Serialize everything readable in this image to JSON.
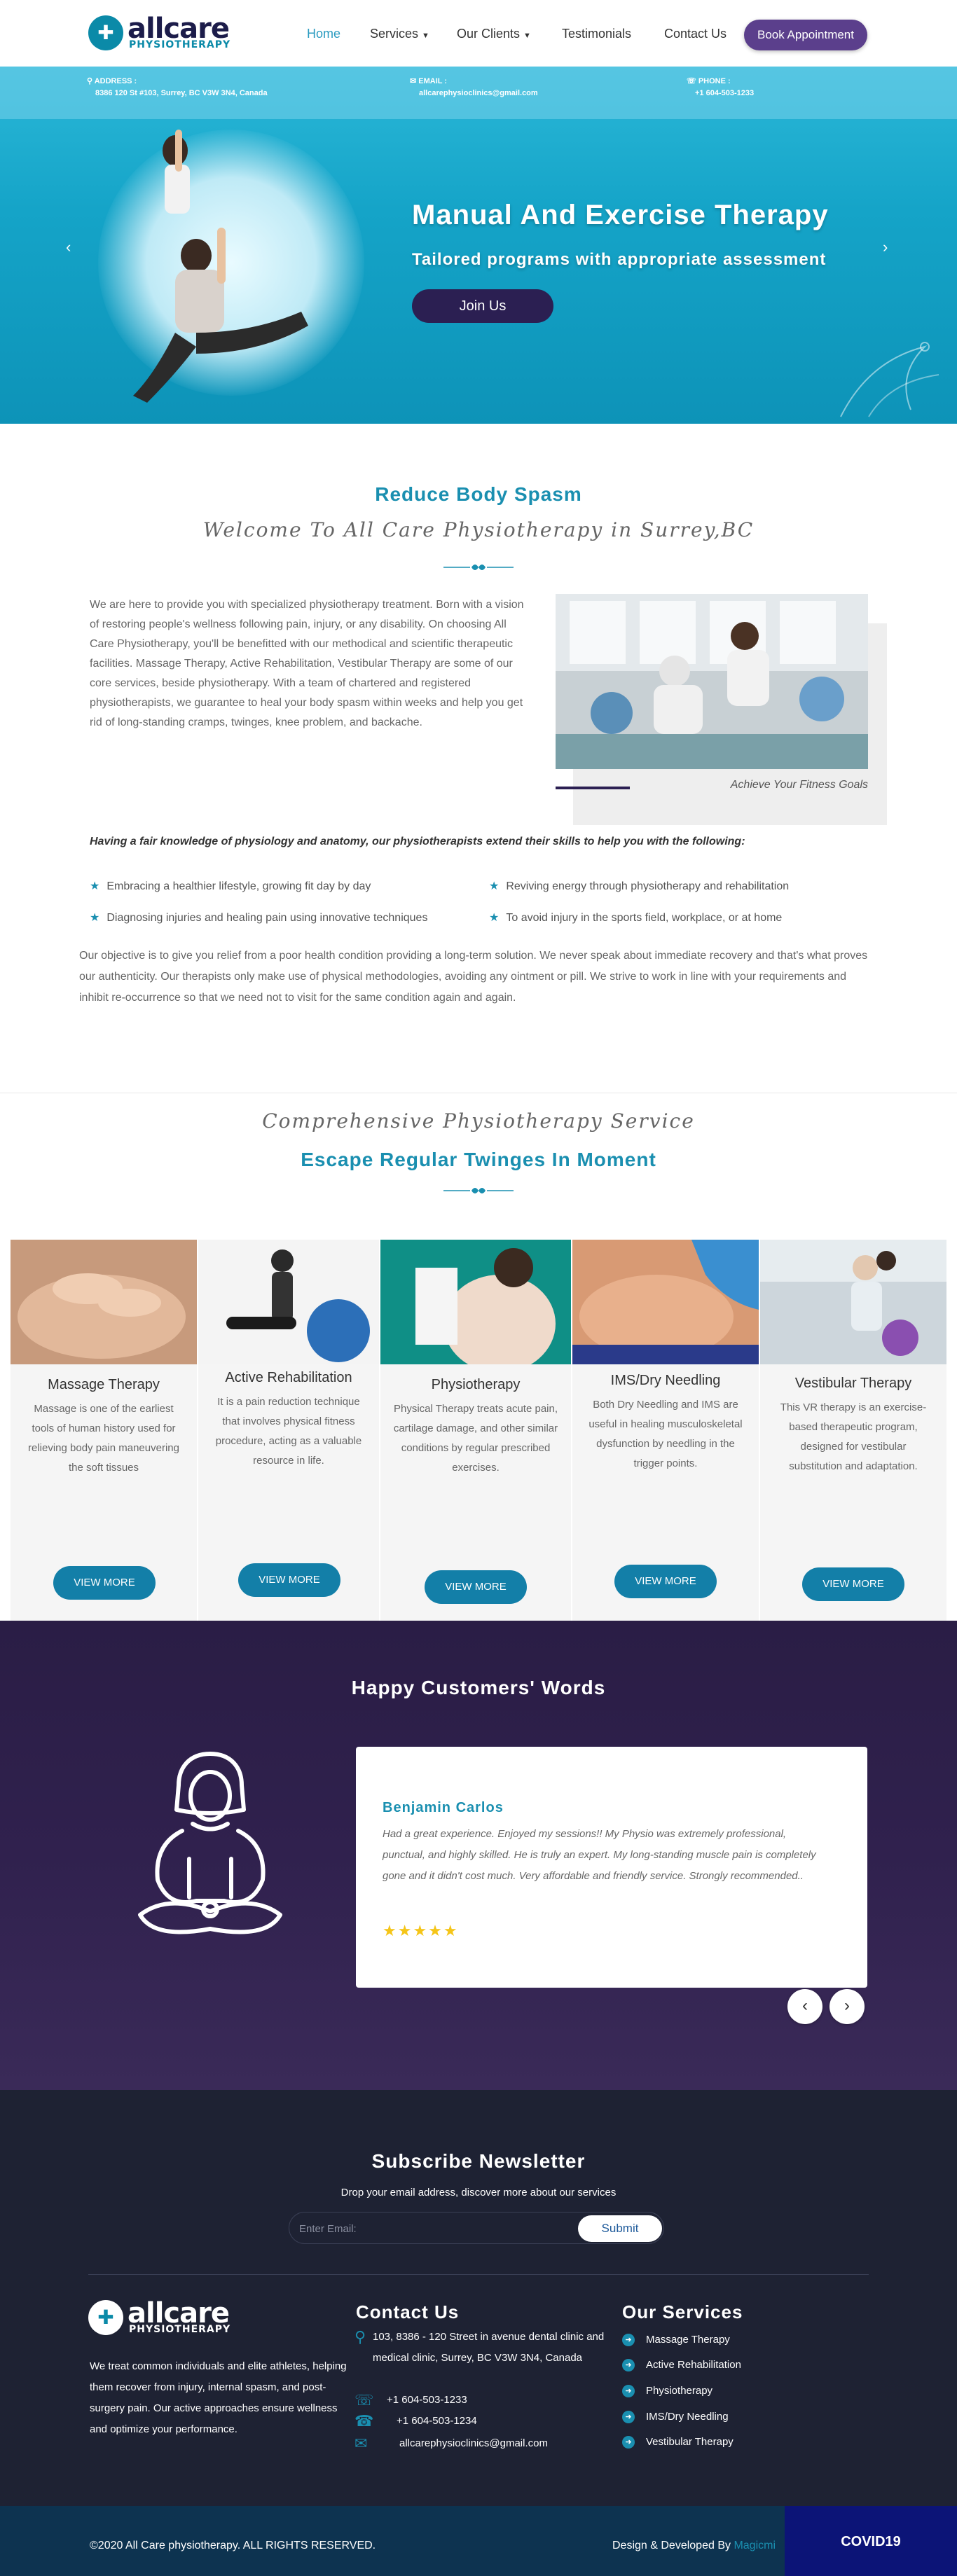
{
  "brand": {
    "name": "allcare",
    "tagline": "PHYSIOTHERAPY"
  },
  "nav": {
    "items": [
      "Home",
      "Services",
      "Our Clients",
      "Testimonials",
      "Contact Us"
    ],
    "book_label": "Book Appointment"
  },
  "infobar": {
    "address_label": "ADDRESS :",
    "address": "8386 120 St #103, Surrey, BC V3W 3N4, Canada",
    "email_label": "EMAIL :",
    "email": "allcarephysioclinics@gmail.com",
    "phone_label": "PHONE :",
    "phone": "+1 604-503-1233"
  },
  "hero": {
    "title": "Manual And Exercise Therapy",
    "subtitle": "Tailored programs with appropriate assessment",
    "button": "Join Us"
  },
  "intro": {
    "title": "Reduce Body Spasm",
    "subtitle": "Welcome To All Care Physiotherapy in Surrey,BC",
    "paragraph": "We are here to provide you with specialized physiotherapy treatment. Born with a vision of restoring people's wellness following pain, injury, or any disability. On choosing All Care Physiotherapy, you'll be benefitted with our methodical and scientific therapeutic facilities. Massage Therapy, Active Rehabilitation, Vestibular Therapy are some of our core services, beside physiotherapy. With a team of chartered and registered physiotherapists, we guarantee to heal your body spasm within weeks and help you get rid of long-standing cramps, twinges, knee problem, and backache.",
    "caption": "Achieve Your Fitness Goals",
    "knowledge": "Having a fair knowledge of physiology and anatomy, our physiotherapists extend their skills to help you with the following:",
    "bullets": [
      "Embracing a healthier lifestyle, growing fit day by day",
      "Reviving energy through physiotherapy and rehabilitation",
      "Diagnosing injuries and healing pain using innovative techniques",
      "To avoid injury in the sports field, workplace, or at home"
    ],
    "objective": "Our objective is to give you relief from a poor health condition providing a long-term solution. We never speak about immediate recovery and that's what proves our authenticity. Our therapists only make use of physical methodologies, avoiding any ointment or pill. We strive to work in line with your requirements and inhibit re-occurrence so that we need not to visit for the same condition again and again."
  },
  "services": {
    "title": "Comprehensive Physiotherapy Service",
    "subtitle": "Escape Regular Twinges In Moment",
    "button_label": "VIEW MORE",
    "cards": [
      {
        "title": "Massage Therapy",
        "desc": "Massage is one of the earliest tools of human history used for relieving body pain maneuvering the soft tissues"
      },
      {
        "title": "Active Rehabilitation",
        "desc": "It is a pain reduction technique that involves physical fitness procedure, acting as a valuable resource in life."
      },
      {
        "title": "Physiotherapy",
        "desc": "Physical Therapy treats acute pain, cartilage damage, and other similar conditions by regular prescribed exercises."
      },
      {
        "title": "IMS/Dry Needling",
        "desc": "Both Dry Needling and IMS are useful in healing musculoskeletal dysfunction by needling in the trigger points."
      },
      {
        "title": "Vestibular Therapy",
        "desc": "This VR therapy is an exercise-based therapeutic program, designed for vestibular substitution and adaptation."
      }
    ]
  },
  "testimonials": {
    "title": "Happy Customers' Words",
    "name": "Benjamin Carlos",
    "text": "Had a great experience. Enjoyed my sessions!! My Physio was extremely professional, punctual, and highly skilled. He is truly an expert. My long-standing muscle pain is completely gone and it didn't cost much. Very affordable and friendly service. Strongly recommended..",
    "stars": "★★★★★",
    "rating": 5
  },
  "newsletter": {
    "title": "Subscribe Newsletter",
    "subtitle": "Drop your email address, discover more about our services",
    "placeholder": "Enter Email:",
    "button": "Submit"
  },
  "footer": {
    "about": "We treat common individuals and elite athletes, helping them recover from injury, internal spasm, and post-surgery pain. Our active approaches ensure wellness and optimize your performance.",
    "contact_title": "Contact Us",
    "address": "103, 8386 - 120 Street in avenue dental clinic and medical clinic, Surrey, BC V3W 3N4, Canada",
    "phone1": "+1 604-503-1233",
    "phone2": "+1 604-503-1234",
    "email": "allcarephysioclinics@gmail.com",
    "services_title": "Our Services",
    "services": [
      "Massage Therapy",
      "Active Rehabilitation",
      "Physiotherapy",
      "IMS/Dry Needling",
      "Vestibular Therapy"
    ],
    "copyright": "©2020 All Care physiotherapy. ALL RIGHTS RESERVED.",
    "design_prefix": "Design & Developed By",
    "design_link": "Magicmi",
    "covid": "COVID19"
  },
  "colors": {
    "primary": "#1a8fb0",
    "accent_purple": "#5b3f8c",
    "dark_navy": "#1e2233",
    "covid_blue": "#0c1477"
  }
}
